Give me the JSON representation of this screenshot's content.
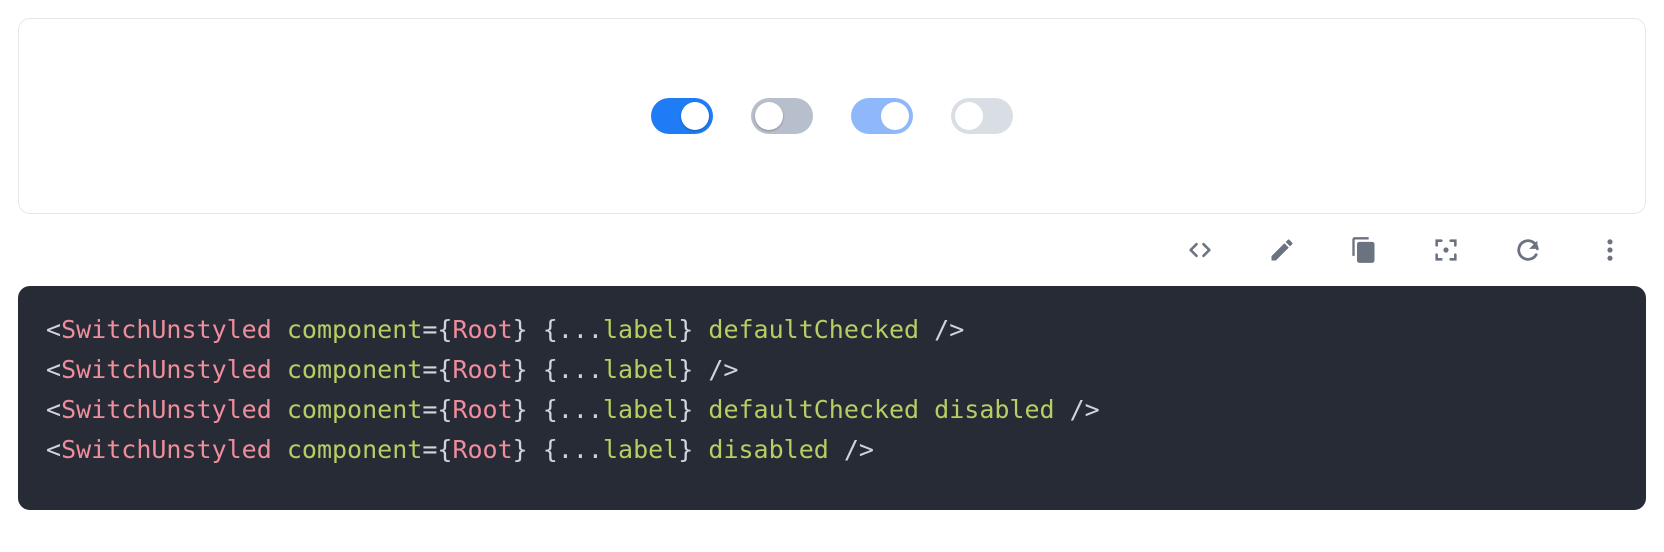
{
  "demo": {
    "switches": [
      {
        "checked": true,
        "disabled": false
      },
      {
        "checked": false,
        "disabled": false
      },
      {
        "checked": true,
        "disabled": true
      },
      {
        "checked": false,
        "disabled": true
      }
    ],
    "colors": {
      "on": "#1f7cf5",
      "off": "#b6bfcb",
      "on_disabled": "#8eb8f9",
      "off_disabled": "#d9dee5",
      "thumb": "#ffffff"
    }
  },
  "toolbar": {
    "icons": [
      "code-icon",
      "edit-icon",
      "copy-icon",
      "focus-icon",
      "refresh-icon",
      "more-icon"
    ]
  },
  "code": {
    "background": "#262b36",
    "lines": [
      {
        "tag": "SwitchUnstyled",
        "component_attr": "component",
        "component_open": "{",
        "component_value": "Root",
        "component_close": "}",
        "spread_open": "{...",
        "spread_value": "label",
        "spread_close": "}",
        "extra": "defaultChecked"
      },
      {
        "tag": "SwitchUnstyled",
        "component_attr": "component",
        "component_open": "{",
        "component_value": "Root",
        "component_close": "}",
        "spread_open": "{...",
        "spread_value": "label",
        "spread_close": "}",
        "extra": ""
      },
      {
        "tag": "SwitchUnstyled",
        "component_attr": "component",
        "component_open": "{",
        "component_value": "Root",
        "component_close": "}",
        "spread_open": "{...",
        "spread_value": "label",
        "spread_close": "}",
        "extra": "defaultChecked disabled"
      },
      {
        "tag": "SwitchUnstyled",
        "component_attr": "component",
        "component_open": "{",
        "component_value": "Root",
        "component_close": "}",
        "spread_open": "{...",
        "spread_value": "label",
        "spread_close": "}",
        "extra": "disabled"
      }
    ]
  }
}
